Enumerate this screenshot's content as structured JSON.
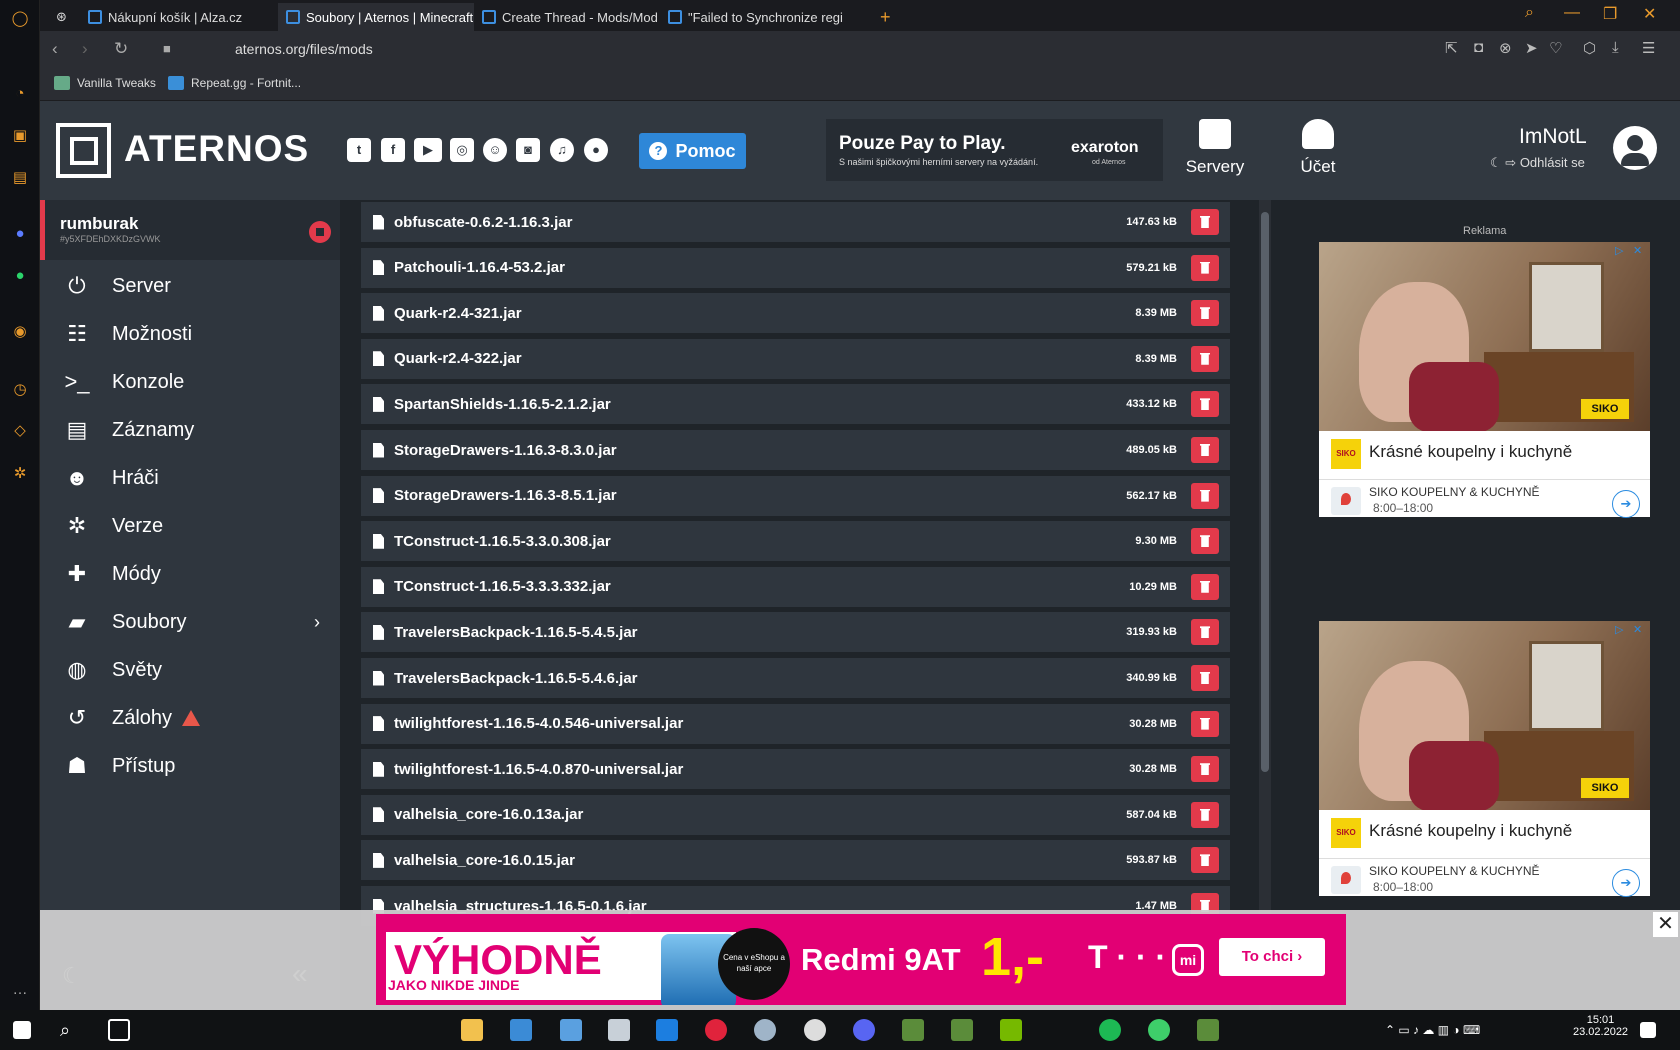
{
  "browser": {
    "tabs": [
      {
        "label": "Nákupní košík | Alza.cz",
        "active": false
      },
      {
        "label": "Soubory | Aternos | Minecraft",
        "active": true
      },
      {
        "label": "Create Thread - Mods/Mod",
        "active": false
      },
      {
        "label": "\"Failed to Synchronize regi",
        "active": false
      }
    ],
    "url": "aternos.org/files/mods",
    "bookmarks": [
      "Vanilla Tweaks",
      "Repeat.gg - Fortnit..."
    ]
  },
  "header": {
    "logo_text": "ATERNOS",
    "social_icons": [
      "twitter-icon",
      "facebook-icon",
      "youtube-icon",
      "instagram-icon",
      "reddit-icon",
      "discord-icon",
      "headset-icon",
      "github-icon"
    ],
    "help_label": "Pomoc",
    "ad": {
      "title": "Pouze Pay to Play.",
      "subtitle": "S našimi špičkovými herními servery na vyžádání.",
      "brand": "exaroton",
      "brand_sub": "od Aternos"
    },
    "nav": [
      {
        "label": "Servery",
        "icon": "servers-icon"
      },
      {
        "label": "Účet",
        "icon": "account-icon"
      }
    ],
    "user": {
      "name": "ImNotL",
      "logout": "Odhlásit se"
    }
  },
  "sidebar": {
    "server_name": "rumburak",
    "server_id": "#y5XFDEhDXKDzGVWK",
    "items": [
      {
        "label": "Server",
        "icon": "power-icon"
      },
      {
        "label": "Možnosti",
        "icon": "sliders-icon"
      },
      {
        "label": "Konzole",
        "icon": "terminal-icon"
      },
      {
        "label": "Záznamy",
        "icon": "document-icon"
      },
      {
        "label": "Hráči",
        "icon": "users-icon"
      },
      {
        "label": "Verze",
        "icon": "gears-icon"
      },
      {
        "label": "Módy",
        "icon": "puzzle-icon"
      },
      {
        "label": "Soubory",
        "icon": "folder-icon"
      },
      {
        "label": "Světy",
        "icon": "globe-icon"
      },
      {
        "label": "Zálohy",
        "icon": "history-icon"
      },
      {
        "label": "Přístup",
        "icon": "user-lock-icon"
      }
    ]
  },
  "files": [
    {
      "name": "obfuscate-0.6.2-1.16.3.jar",
      "size": "147.63 kB"
    },
    {
      "name": "Patchouli-1.16.4-53.2.jar",
      "size": "579.21 kB"
    },
    {
      "name": "Quark-r2.4-321.jar",
      "size": "8.39 MB"
    },
    {
      "name": "Quark-r2.4-322.jar",
      "size": "8.39 MB"
    },
    {
      "name": "SpartanShields-1.16.5-2.1.2.jar",
      "size": "433.12 kB"
    },
    {
      "name": "StorageDrawers-1.16.3-8.3.0.jar",
      "size": "489.05 kB"
    },
    {
      "name": "StorageDrawers-1.16.3-8.5.1.jar",
      "size": "562.17 kB"
    },
    {
      "name": "TConstruct-1.16.5-3.3.0.308.jar",
      "size": "9.30 MB"
    },
    {
      "name": "TConstruct-1.16.5-3.3.3.332.jar",
      "size": "10.29 MB"
    },
    {
      "name": "TravelersBackpack-1.16.5-5.4.5.jar",
      "size": "319.93 kB"
    },
    {
      "name": "TravelersBackpack-1.16.5-5.4.6.jar",
      "size": "340.99 kB"
    },
    {
      "name": "twilightforest-1.16.5-4.0.546-universal.jar",
      "size": "30.28 MB"
    },
    {
      "name": "twilightforest-1.16.5-4.0.870-universal.jar",
      "size": "30.28 MB"
    },
    {
      "name": "valhelsia_core-16.0.13a.jar",
      "size": "587.04 kB"
    },
    {
      "name": "valhelsia_core-16.0.15.jar",
      "size": "593.87 kB"
    },
    {
      "name": "valhelsia_structures-1.16.5-0.1.6.jar",
      "size": "1.47 MB"
    }
  ],
  "ads": {
    "label": "Reklama",
    "side": [
      {
        "title": "Krásné koupelny i kuchyně",
        "shop": "SIKO KOUPELNY & KUCHYNĚ",
        "hours": "8:00–18:00",
        "logo": "SIKO"
      },
      {
        "title": "Krásné koupelny i kuchyně",
        "shop": "SIKO KOUPELNY & KUCHYNĚ",
        "hours": "8:00–18:00",
        "logo": "SIKO"
      }
    ],
    "banner": {
      "headline": "VÝHODNĚ",
      "sub": "JAKO NIKDE JINDE",
      "badge": "Cena v eShopu a naší apce",
      "model": "Redmi 9AT",
      "price": "1,-",
      "telekom": "T · · ·",
      "mi": "mi",
      "cta": "To chci ›"
    }
  },
  "taskbar": {
    "time": "15:01",
    "date": "23.02.2022"
  },
  "colors": {
    "accent_red": "#e33a4b",
    "accent_blue": "#2e87d8",
    "sidebar": "#2f363e",
    "banner": "#e20074"
  }
}
